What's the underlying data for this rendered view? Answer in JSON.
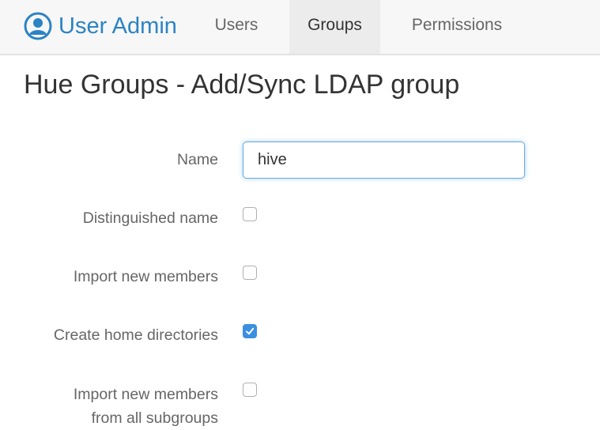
{
  "navbar": {
    "brand": "User Admin",
    "brand_icon": "user-circle-icon",
    "tabs": [
      {
        "label": "Users",
        "active": false
      },
      {
        "label": "Groups",
        "active": true
      },
      {
        "label": "Permissions",
        "active": false
      }
    ]
  },
  "page": {
    "title": "Hue Groups - Add/Sync LDAP group"
  },
  "form": {
    "name": {
      "label": "Name",
      "value": "hive"
    },
    "distinguished_name": {
      "label": "Distinguished name",
      "checked": false
    },
    "import_new_members": {
      "label": "Import new members",
      "checked": false
    },
    "create_home_directories": {
      "label": "Create home directories",
      "checked": true
    },
    "import_subgroups": {
      "label_line1": "Import new members",
      "label_line2": "from all subgroups",
      "checked": false
    }
  },
  "colors": {
    "brand": "#2b83c4",
    "checkbox_checked": "#3b8fe0",
    "input_focus_border": "#66a9e6"
  }
}
